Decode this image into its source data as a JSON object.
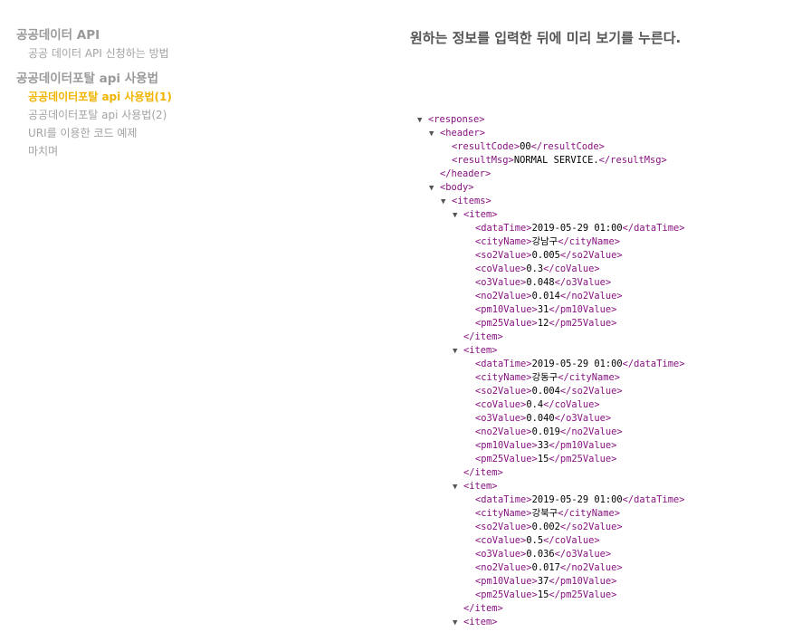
{
  "toc": {
    "sections": [
      {
        "title": "공공데이터 API",
        "items": [
          {
            "label": "공공 데이터 API 신청하는 방법",
            "active": false
          }
        ]
      },
      {
        "title": "공공데이터포탈 api 사용법",
        "items": [
          {
            "label": "공공데이터포탈 api 사용법(1)",
            "active": true
          },
          {
            "label": "공공데이터포탈 api 사용법(2)",
            "active": false
          },
          {
            "label": "URI를 이용한 코드 예제",
            "active": false
          },
          {
            "label": "마치며",
            "active": false
          }
        ]
      }
    ]
  },
  "instruction": "원하는 정보를 입력한 뒤에 미리 보기를 누른다.",
  "xml": {
    "toggle_glyph": "▼",
    "header": {
      "resultCode": "00",
      "resultMsg": "NORMAL SERVICE."
    },
    "items": [
      {
        "dataTime": "2019-05-29 01:00",
        "cityName": "강남구",
        "so2Value": "0.005",
        "coValue": "0.3",
        "o3Value": "0.048",
        "no2Value": "0.014",
        "pm10Value": "31",
        "pm25Value": "12"
      },
      {
        "dataTime": "2019-05-29 01:00",
        "cityName": "강동구",
        "so2Value": "0.004",
        "coValue": "0.4",
        "o3Value": "0.040",
        "no2Value": "0.019",
        "pm10Value": "33",
        "pm25Value": "15"
      },
      {
        "dataTime": "2019-05-29 01:00",
        "cityName": "강북구",
        "so2Value": "0.002",
        "coValue": "0.5",
        "o3Value": "0.036",
        "no2Value": "0.017",
        "pm10Value": "37",
        "pm25Value": "15"
      }
    ]
  },
  "colors": {
    "tag": "#881280",
    "active": "#f0b400",
    "muted": "#a3a3a3"
  }
}
